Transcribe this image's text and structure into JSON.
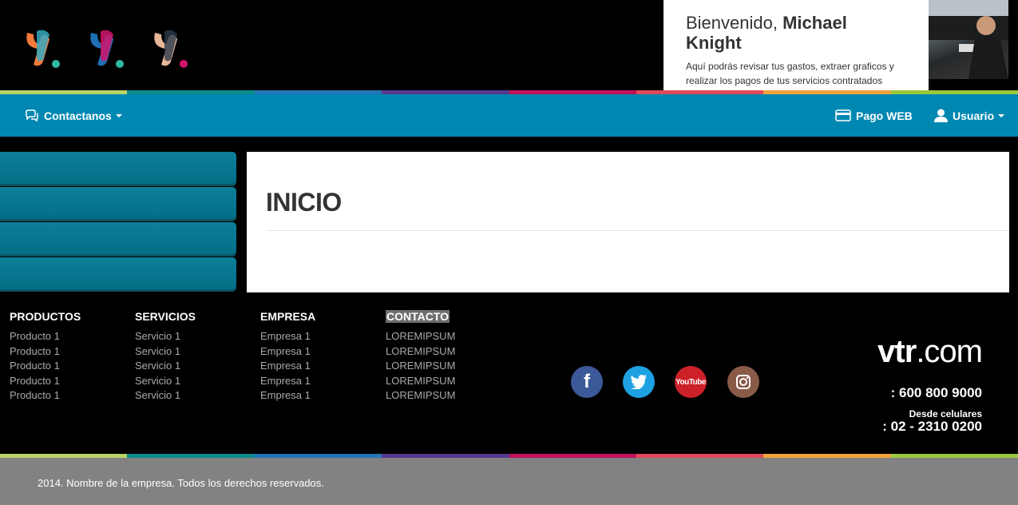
{
  "welcome": {
    "greeting": "Bienvenido,",
    "user_name": "Michael Knight",
    "message": "Aquí podrás revisar tus gastos, extraer graficos y realizar los pagos de tus servicios contratados"
  },
  "navbar": {
    "contact_label": "Contactanos",
    "pay_label": "Pago WEB",
    "user_label": "Usuario"
  },
  "main": {
    "title": "INICIO"
  },
  "footer": {
    "columns": [
      {
        "heading": "PRODUCTOS",
        "items": [
          "Producto 1",
          "Producto 1",
          "Producto 1",
          "Producto 1",
          "Producto 1"
        ]
      },
      {
        "heading": "SERVICIOS",
        "items": [
          "Servicio 1",
          "Servicio 1",
          "Servicio 1",
          "Servicio 1",
          "Servicio 1"
        ]
      },
      {
        "heading": "EMPRESA",
        "items": [
          "Empresa 1",
          "Empresa 1",
          "Empresa 1",
          "Empresa 1",
          "Empresa 1"
        ]
      },
      {
        "heading": "CONTACTO",
        "items": [
          "LOREMIPSUM",
          "LOREMIPSUM",
          "LOREMIPSUM",
          "LOREMIPSUM",
          "LOREMIPSUM"
        ]
      }
    ],
    "social": [
      {
        "icon": "facebook-icon",
        "glyph": "f",
        "color": "#3b5998"
      },
      {
        "icon": "twitter-icon",
        "glyph": "t",
        "color": "#1da1e2"
      },
      {
        "icon": "youtube-icon",
        "glyph": "YouTube",
        "color": "#cc2128"
      },
      {
        "icon": "instagram-icon",
        "glyph": "",
        "color": "#8a5a48"
      }
    ],
    "brand_main": "vtr",
    "brand_suffix": ".com",
    "phone_main": ": 600 800 9000",
    "mobile_label": "Desde celulares",
    "phone_mobile": ": 02 - 2310 0200",
    "copyright": "2014. Nombre de la empresa. Todos los derechos reservados."
  },
  "colors": {
    "navbar": "#0088b2",
    "sidebar_button": "#036f87",
    "footer_bar": "#828282",
    "stripe": [
      "#b9d26a",
      "#0a8c8a",
      "#2276b8",
      "#55398f",
      "#c0135a",
      "#e14a5b",
      "#f0a33c",
      "#9bc73f"
    ]
  }
}
